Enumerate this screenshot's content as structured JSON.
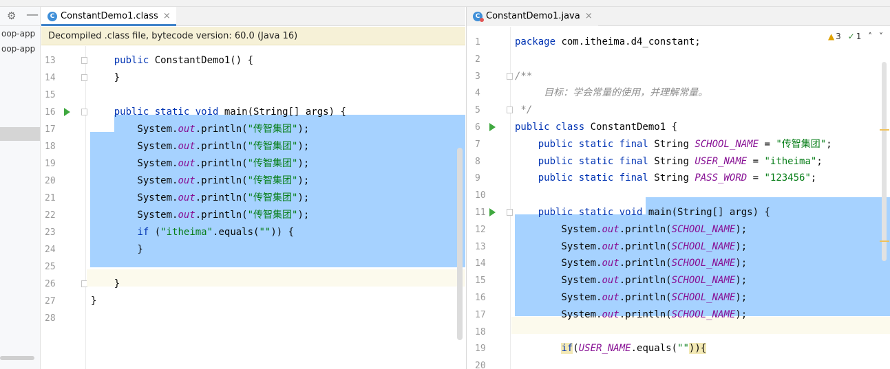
{
  "sidebar": {
    "items": [
      "oop-app",
      "oop-app"
    ]
  },
  "left_editor": {
    "tab_label": "ConstantDemo1.class",
    "tab_icon": "class-file-icon",
    "notice": "Decompiled .class file, bytecode version: 60.0 (Java 16)",
    "lines": [
      {
        "n": "13",
        "tokens": [
          [
            "plain",
            "    "
          ],
          [
            "kw",
            "public "
          ],
          [
            "plain",
            "ConstantDemo1() {"
          ]
        ]
      },
      {
        "n": "14",
        "tokens": [
          [
            "plain",
            "    }"
          ]
        ]
      },
      {
        "n": "15",
        "tokens": []
      },
      {
        "n": "16",
        "tokens": [
          [
            "plain",
            "    "
          ],
          [
            "kw",
            "public static void "
          ],
          [
            "plain",
            "main(String[] args) {"
          ]
        ]
      },
      {
        "n": "17",
        "tokens": [
          [
            "plain",
            "        System."
          ],
          [
            "fld",
            "out"
          ],
          [
            "plain",
            ".println("
          ],
          [
            "str",
            "\"传智集团\""
          ],
          [
            "plain",
            ");"
          ]
        ]
      },
      {
        "n": "18",
        "tokens": [
          [
            "plain",
            "        System."
          ],
          [
            "fld",
            "out"
          ],
          [
            "plain",
            ".println("
          ],
          [
            "str",
            "\"传智集团\""
          ],
          [
            "plain",
            ");"
          ]
        ]
      },
      {
        "n": "19",
        "tokens": [
          [
            "plain",
            "        System."
          ],
          [
            "fld",
            "out"
          ],
          [
            "plain",
            ".println("
          ],
          [
            "str",
            "\"传智集团\""
          ],
          [
            "plain",
            ");"
          ]
        ]
      },
      {
        "n": "20",
        "tokens": [
          [
            "plain",
            "        System."
          ],
          [
            "fld",
            "out"
          ],
          [
            "plain",
            ".println("
          ],
          [
            "str",
            "\"传智集团\""
          ],
          [
            "plain",
            ");"
          ]
        ]
      },
      {
        "n": "21",
        "tokens": [
          [
            "plain",
            "        System."
          ],
          [
            "fld",
            "out"
          ],
          [
            "plain",
            ".println("
          ],
          [
            "str",
            "\"传智集团\""
          ],
          [
            "plain",
            ");"
          ]
        ]
      },
      {
        "n": "22",
        "tokens": [
          [
            "plain",
            "        System."
          ],
          [
            "fld",
            "out"
          ],
          [
            "plain",
            ".println("
          ],
          [
            "str",
            "\"传智集团\""
          ],
          [
            "plain",
            ");"
          ]
        ]
      },
      {
        "n": "23",
        "tokens": [
          [
            "plain",
            "        "
          ],
          [
            "kw",
            "if "
          ],
          [
            "plain",
            "("
          ],
          [
            "str",
            "\"itheima\""
          ],
          [
            "plain",
            ".equals("
          ],
          [
            "str",
            "\"\""
          ],
          [
            "plain",
            ")) {"
          ]
        ]
      },
      {
        "n": "24",
        "tokens": [
          [
            "plain",
            "        }"
          ]
        ]
      },
      {
        "n": "25",
        "tokens": []
      },
      {
        "n": "26",
        "tokens": [
          [
            "plain",
            "    }"
          ]
        ]
      },
      {
        "n": "27",
        "tokens": [
          [
            "plain",
            "}"
          ]
        ]
      },
      {
        "n": "28",
        "tokens": []
      }
    ]
  },
  "right_editor": {
    "tab_label": "ConstantDemo1.java",
    "tab_icon": "java-file-icon",
    "inspection": {
      "warnings": "3",
      "weak_warnings": "1"
    },
    "lines": [
      {
        "n": "1",
        "tokens": [
          [
            "kw",
            "package "
          ],
          [
            "plain",
            "com.itheima.d4_constant;"
          ]
        ]
      },
      {
        "n": "2",
        "tokens": []
      },
      {
        "n": "3",
        "tokens": [
          [
            "cmt",
            "/**"
          ]
        ]
      },
      {
        "n": "4",
        "tokens": [
          [
            "cmt",
            "     目标：学会常量的使用，并理解常量。"
          ]
        ]
      },
      {
        "n": "5",
        "tokens": [
          [
            "cmt",
            " */"
          ]
        ]
      },
      {
        "n": "6",
        "tokens": [
          [
            "kw",
            "public class "
          ],
          [
            "plain",
            "ConstantDemo1 {"
          ]
        ]
      },
      {
        "n": "7",
        "tokens": [
          [
            "plain",
            "    "
          ],
          [
            "kw",
            "public static final "
          ],
          [
            "plain",
            "String "
          ],
          [
            "cst",
            "SCHOOL_NAME"
          ],
          [
            "plain",
            " = "
          ],
          [
            "str",
            "\"传智集团\""
          ],
          [
            "plain",
            ";"
          ]
        ]
      },
      {
        "n": "8",
        "tokens": [
          [
            "plain",
            "    "
          ],
          [
            "kw",
            "public static final "
          ],
          [
            "plain",
            "String "
          ],
          [
            "cst",
            "USER_NAME"
          ],
          [
            "plain",
            " = "
          ],
          [
            "str",
            "\"itheima\""
          ],
          [
            "plain",
            ";"
          ]
        ]
      },
      {
        "n": "9",
        "tokens": [
          [
            "plain",
            "    "
          ],
          [
            "kw",
            "public static final "
          ],
          [
            "plain",
            "String "
          ],
          [
            "cst",
            "PASS_WORD"
          ],
          [
            "plain",
            " = "
          ],
          [
            "str",
            "\"123456\""
          ],
          [
            "plain",
            ";"
          ]
        ]
      },
      {
        "n": "10",
        "tokens": []
      },
      {
        "n": "11",
        "tokens": [
          [
            "plain",
            "    "
          ],
          [
            "kw",
            "public static void "
          ],
          [
            "plain",
            "main(String[] args) {"
          ]
        ]
      },
      {
        "n": "12",
        "tokens": [
          [
            "plain",
            "        System."
          ],
          [
            "fld",
            "out"
          ],
          [
            "plain",
            ".println("
          ],
          [
            "cst",
            "SCHOOL_NAME"
          ],
          [
            "plain",
            ");"
          ]
        ]
      },
      {
        "n": "13",
        "tokens": [
          [
            "plain",
            "        System."
          ],
          [
            "fld",
            "out"
          ],
          [
            "plain",
            ".println("
          ],
          [
            "cst",
            "SCHOOL_NAME"
          ],
          [
            "plain",
            ");"
          ]
        ]
      },
      {
        "n": "14",
        "tokens": [
          [
            "plain",
            "        System."
          ],
          [
            "fld",
            "out"
          ],
          [
            "plain",
            ".println("
          ],
          [
            "cst",
            "SCHOOL_NAME"
          ],
          [
            "plain",
            ");"
          ]
        ]
      },
      {
        "n": "15",
        "tokens": [
          [
            "plain",
            "        System."
          ],
          [
            "fld",
            "out"
          ],
          [
            "plain",
            ".println("
          ],
          [
            "cst",
            "SCHOOL_NAME"
          ],
          [
            "plain",
            ");"
          ]
        ]
      },
      {
        "n": "16",
        "tokens": [
          [
            "plain",
            "        System."
          ],
          [
            "fld",
            "out"
          ],
          [
            "plain",
            ".println("
          ],
          [
            "cst",
            "SCHOOL_NAME"
          ],
          [
            "plain",
            ");"
          ]
        ]
      },
      {
        "n": "17",
        "tokens": [
          [
            "plain",
            "        System."
          ],
          [
            "fld",
            "out"
          ],
          [
            "plain",
            ".println("
          ],
          [
            "cst",
            "SCHOOL_NAME"
          ],
          [
            "plain",
            ");"
          ]
        ]
      },
      {
        "n": "18",
        "tokens": []
      },
      {
        "n": "19",
        "tokens": [
          [
            "plain",
            "        "
          ],
          [
            "kw",
            "if"
          ],
          [
            "plain",
            "("
          ],
          [
            "cst",
            "USER_NAME"
          ],
          [
            "plain",
            ".equals("
          ],
          [
            "str",
            "\"\""
          ],
          [
            "plain",
            ")){"
          ]
        ]
      },
      {
        "n": "20",
        "tokens": []
      }
    ]
  },
  "colors": {
    "selection": "#a6d2ff",
    "keyword": "#0033b3",
    "string": "#067d17",
    "field": "#871094",
    "notice_bg": "#f6f1d7"
  }
}
